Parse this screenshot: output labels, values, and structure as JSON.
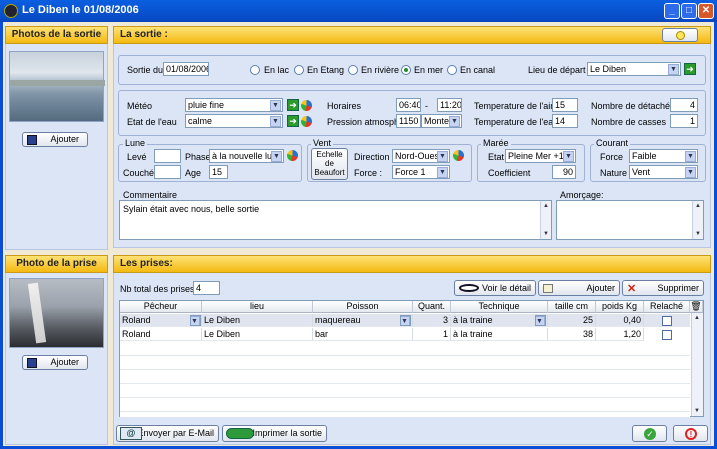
{
  "window": {
    "title": "Le Diben le 01/08/2006",
    "min": "_",
    "max": "□",
    "close": "✕"
  },
  "left": {
    "photos_title": "Photos de la sortie",
    "add1": "Ajouter",
    "prise_title": "Photo de la prise",
    "add2": "Ajouter"
  },
  "sortie": {
    "title": "La sortie :",
    "date_label": "Sortie du",
    "date": "01/08/2006",
    "radios": [
      {
        "label": "En lac",
        "on": false
      },
      {
        "label": "En Etang",
        "on": false
      },
      {
        "label": "En rivière",
        "on": false
      },
      {
        "label": "En mer",
        "on": true
      },
      {
        "label": "En canal",
        "on": false
      }
    ],
    "lieu_label": "Lieu de départ",
    "lieu": "Le Diben",
    "meteo_label": "Météo",
    "meteo": "pluie fine",
    "eau_label": "Etat de l'eau",
    "eau": "calme",
    "horaires_label": "Horaires",
    "h1": "06:40",
    "dash": "-",
    "h2": "11:20",
    "pression_label": "Pression atmosph.",
    "pression": "1150",
    "pression_trend": "Monte",
    "tair_label": "Temperature de l'air",
    "tair": "15",
    "teau_label": "Temperature de l'eau",
    "teau": "14",
    "detaches_label": "Nombre de détachés",
    "detaches": "4",
    "casses_label": "Nombre de casses",
    "casses": "1",
    "lune": {
      "legend": "Lune",
      "leve": "Levé",
      "couche": "Couché",
      "phase_label": "Phase",
      "phase": "à la nouvelle lune",
      "age_label": "Age",
      "age": "15"
    },
    "vent": {
      "legend": "Vent",
      "echelle": "Echelle de Beaufort",
      "direction_label": "Direction",
      "direction": "Nord-Ouest",
      "force_label": "Force :",
      "force": "Force 1"
    },
    "maree": {
      "legend": "Marée",
      "etat_label": "Etat",
      "etat": "Pleine Mer +1h",
      "coef_label": "Coefficient",
      "coef": "90"
    },
    "courant": {
      "legend": "Courant",
      "force_label": "Force",
      "force": "Faible",
      "nature_label": "Nature",
      "nature": "Vent"
    },
    "commentaire_label": "Commentaire",
    "commentaire": "Sylain était avec nous, belle sortie",
    "amorcage_label": "Amorçage:"
  },
  "prises": {
    "title": "Les prises:",
    "nb_label": "Nb total des prises",
    "nb": "4",
    "detail": "Voir le détail",
    "add": "Ajouter",
    "del": "Supprimer",
    "headers": [
      "Pêcheur",
      "lieu",
      "Poisson",
      "Quant.",
      "Technique",
      "taille cm",
      "poids Kg",
      "Relaché"
    ],
    "rows": [
      [
        "Roland",
        "Le Diben",
        "maquereau",
        "3",
        "à la traine",
        "25",
        "0,40"
      ],
      [
        "Roland",
        "Le Diben",
        "bar",
        "1",
        "à la traine",
        "38",
        "1,20"
      ]
    ]
  },
  "footer": {
    "email": "Envoyer par E-Mail",
    "print": "Imprimer la sortie"
  }
}
